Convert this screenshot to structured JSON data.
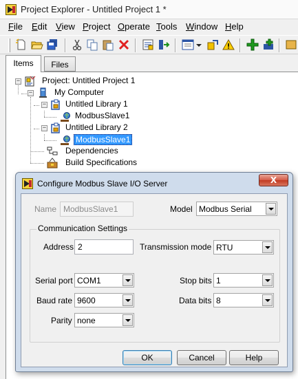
{
  "window": {
    "title": "Project Explorer - Untitled Project 1 *"
  },
  "menu": [
    {
      "label": "File",
      "u": "F",
      "rest": "ile"
    },
    {
      "label": "Edit",
      "u": "E",
      "rest": "dit"
    },
    {
      "label": "View",
      "u": "V",
      "rest": "iew"
    },
    {
      "label": "Project",
      "u": "P",
      "rest": "roject"
    },
    {
      "label": "Operate",
      "u": "O",
      "rest": "perate"
    },
    {
      "label": "Tools",
      "u": "T",
      "rest": "ools"
    },
    {
      "label": "Window",
      "u": "W",
      "rest": "indow"
    },
    {
      "label": "Help",
      "u": "H",
      "rest": "elp"
    }
  ],
  "toolbar_icons": [
    "new-icon",
    "open-icon",
    "save-all-icon",
    "cut-icon",
    "copy-icon",
    "paste-icon",
    "delete-icon",
    "properties-icon",
    "deploy-icon",
    "view-options-icon",
    "dropdown-icon",
    "resolve-icon",
    "warning-icon",
    "add-item-icon",
    "add-folder-icon",
    "more-icon"
  ],
  "tabs": {
    "items": "Items",
    "files": "Files"
  },
  "tree": {
    "project": "Project: Untitled Project 1",
    "computer": "My Computer",
    "library1": "Untitled Library 1",
    "lib1_child": "ModbusSlave1",
    "library2": "Untitled Library 2",
    "lib2_child": "ModbusSlave1",
    "dependencies": "Dependencies",
    "build_specs": "Build Specifications"
  },
  "dialog": {
    "title": "Configure Modbus Slave I/O Server",
    "close": "X",
    "name_label": "Name",
    "name_value": "ModbusSlave1",
    "model_label": "Model",
    "model_value": "Modbus Serial",
    "group_title": "Communication Settings",
    "address_label": "Address",
    "address_value": "2",
    "transmission_label": "Transmission mode",
    "transmission_value": "RTU",
    "serial_port_label": "Serial port",
    "serial_port_value": "COM1",
    "stop_bits_label": "Stop bits",
    "stop_bits_value": "1",
    "baud_rate_label": "Baud rate",
    "baud_rate_value": "9600",
    "data_bits_label": "Data bits",
    "data_bits_value": "8",
    "parity_label": "Parity",
    "parity_value": "none",
    "ok": "OK",
    "cancel": "Cancel",
    "help": "Help"
  }
}
